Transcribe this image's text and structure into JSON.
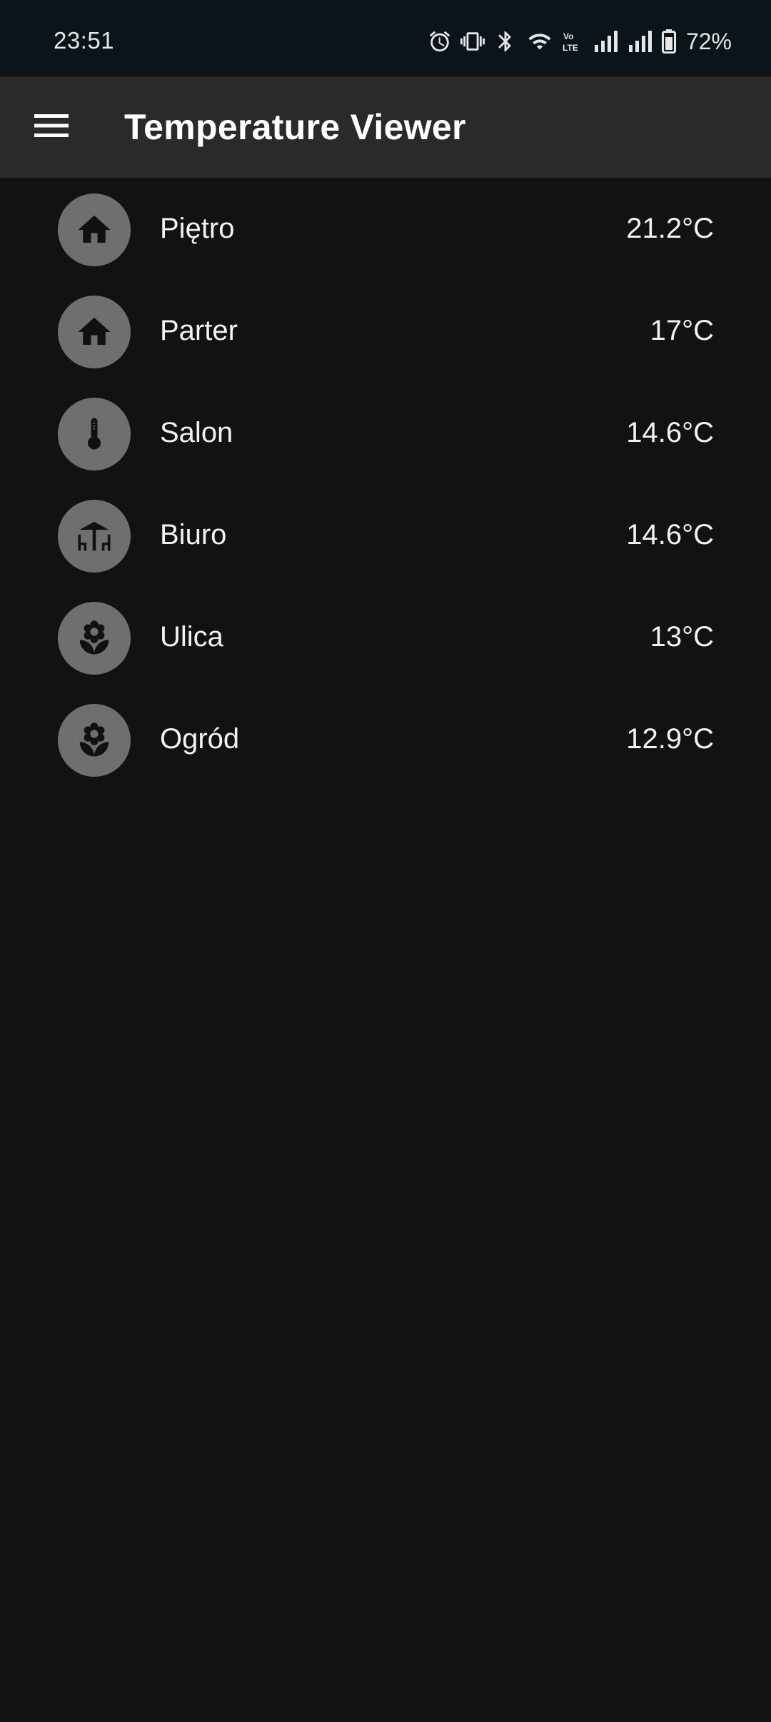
{
  "status_bar": {
    "time": "23:51",
    "battery_percent": "72%",
    "icons": [
      "alarm-icon",
      "vibrate-icon",
      "bluetooth-icon",
      "wifi-icon",
      "volte-icon",
      "signal-icon",
      "signal-icon",
      "battery-icon"
    ]
  },
  "app_bar": {
    "title": "Temperature Viewer",
    "menu_icon": "menu-icon"
  },
  "sensors": [
    {
      "name": "Piętro",
      "temperature": "21.2°C",
      "icon": "home-icon"
    },
    {
      "name": "Parter",
      "temperature": "17°C",
      "icon": "home-icon"
    },
    {
      "name": "Salon",
      "temperature": "14.6°C",
      "icon": "thermometer-icon"
    },
    {
      "name": "Biuro",
      "temperature": "14.6°C",
      "icon": "table-chairs-icon"
    },
    {
      "name": "Ulica",
      "temperature": "13°C",
      "icon": "flower-icon"
    },
    {
      "name": "Ogród",
      "temperature": "12.9°C",
      "icon": "flower-icon"
    }
  ],
  "colors": {
    "background": "#121212",
    "app_bar": "#2a2a2a",
    "status_bar": "#0a1419",
    "avatar": "#6f6f6f",
    "text": "#f2f2f2"
  }
}
